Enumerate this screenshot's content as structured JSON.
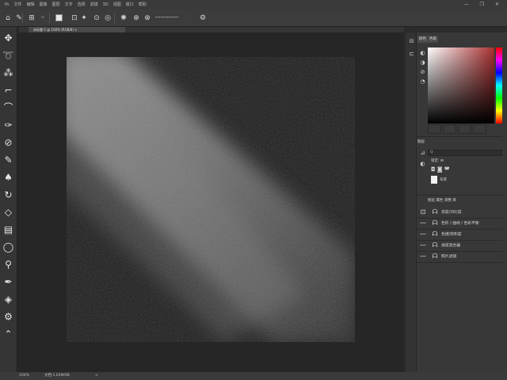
{
  "menubar": {
    "items": [
      "Ps",
      "文件",
      "编辑",
      "图像",
      "图层",
      "文字",
      "选择",
      "滤镜",
      "3D",
      "视图",
      "窗口",
      "帮助"
    ],
    "window_controls": "— ❐ ✕"
  },
  "options_bar": {
    "items": [
      {
        "name": "home-icon",
        "glyph": "⌂"
      },
      {
        "name": "brush-preset-icon",
        "glyph": "✎"
      },
      {
        "name": "mode-icon",
        "glyph": "⊞"
      },
      {
        "name": "brush-size-icon",
        "glyph": "◦"
      },
      {
        "name": "toggle-icon",
        "glyph": "⊡"
      },
      {
        "name": "airbrush-icon",
        "glyph": "✦"
      },
      {
        "name": "pressure-icon",
        "glyph": "⊙"
      },
      {
        "name": "flow-icon",
        "glyph": "◎"
      },
      {
        "name": "smoothing-icon",
        "glyph": "✺"
      },
      {
        "name": "angle-icon",
        "glyph": "⊕"
      },
      {
        "name": "symmetry-icon",
        "glyph": "⊗"
      },
      {
        "name": "settings-icon",
        "glyph": "⚙"
      }
    ],
    "text": "ꟷꟷꟷꟷꟷꟷ"
  },
  "document_tab": {
    "label": "未标题-1 @ 100% (RGB/8) ×"
  },
  "tools": [
    {
      "name": "move-tool-icon",
      "glyph": "✥"
    },
    {
      "name": "lasso-tool-icon",
      "glyph": "➰"
    },
    {
      "name": "wand-tool-icon",
      "glyph": "⁂"
    },
    {
      "name": "crop-tool-icon",
      "glyph": "⌐"
    },
    {
      "name": "frame-tool-icon",
      "glyph": "⌒"
    },
    {
      "name": "eyedropper-tool-icon",
      "glyph": "✑"
    },
    {
      "name": "healing-tool-icon",
      "glyph": "⊘"
    },
    {
      "name": "brush-tool-icon",
      "glyph": "✎"
    },
    {
      "name": "stamp-tool-icon",
      "glyph": "♠"
    },
    {
      "name": "history-brush-icon",
      "glyph": "↻"
    },
    {
      "name": "eraser-tool-icon",
      "glyph": "◇"
    },
    {
      "name": "gradient-tool-icon",
      "glyph": "▤"
    },
    {
      "name": "blur-tool-icon",
      "glyph": "◯"
    },
    {
      "name": "dodge-tool-icon",
      "glyph": "⚲"
    },
    {
      "name": "pen-tool-icon",
      "glyph": "✒"
    },
    {
      "name": "text-tool-icon",
      "glyph": "◈"
    },
    {
      "name": "path-select-icon",
      "glyph": "⚙"
    },
    {
      "name": "shape-tool-icon",
      "glyph": "⌃"
    }
  ],
  "status_bar": {
    "zoom": "100%",
    "doc": "文档:1.03M/0B",
    "info": "> "
  },
  "color_panel": {
    "tabs": [
      "颜色",
      "色板"
    ],
    "side_icons": [
      "◐",
      "◑",
      "⊘",
      "◔"
    ],
    "picker_base_color": "#a83030"
  },
  "layers_panel": {
    "title": "图层",
    "search": "Q",
    "row1": "锁定: ⊞",
    "lock_icons": "◘ ◙ ◚",
    "layer_name": "背景"
  },
  "properties_panel": {
    "header": "图层 属性 调整 库",
    "rows": [
      {
        "label": "亮度/对比度",
        "icon1": "⊡",
        "icon2": "ᗩ"
      },
      {
        "label": "色阶 / 曲线 / 色彩平衡",
        "icon1": "—",
        "icon2": "ᗩ"
      },
      {
        "label": "色相/饱和度",
        "icon1": "—",
        "icon2": "ᗩ"
      },
      {
        "label": "通道混合器",
        "icon1": "—",
        "icon2": "ᗩ"
      },
      {
        "label": "照片滤镜",
        "icon1": "—",
        "icon2": "ᗩ"
      }
    ]
  }
}
